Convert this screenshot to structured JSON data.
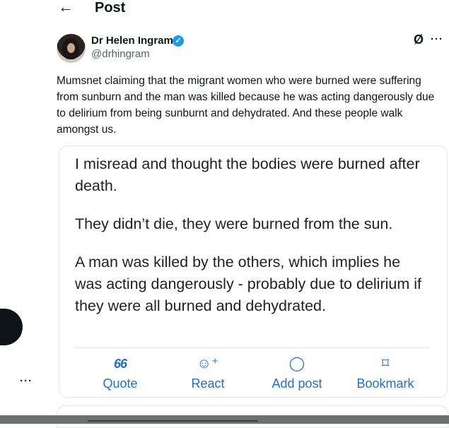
{
  "header": {
    "back_icon": "←",
    "title": "Post"
  },
  "author": {
    "name": "Dr Helen Ingram",
    "handle": "@drhingram",
    "verified_icon": "✓"
  },
  "post_actions": {
    "grok_icon": "Ø",
    "more_icon": "···"
  },
  "post": {
    "text": "Mumsnet claiming that the migrant women who were burned were suffering from sunburn and the man was killed because he was acting dangerously due to delirium from being sunburnt and dehydrated. And these people walk amongst us."
  },
  "quoted": {
    "paragraphs": [
      "I misread and thought the bodies were burned after death.",
      "They didn’t die, they were burned from the sun.",
      "A man was killed by the others, which implies he was acting dangerously - probably due to delirium if they were all burned and dehydrated."
    ],
    "actions": [
      {
        "icon": "66",
        "label": "Quote"
      },
      {
        "icon": "☺⁺",
        "label": "React"
      },
      {
        "icon": "◯",
        "label": "Add post"
      },
      {
        "icon": "⌑",
        "label": "Bookmark"
      }
    ]
  },
  "left_rail": {
    "more_icon": "···"
  }
}
